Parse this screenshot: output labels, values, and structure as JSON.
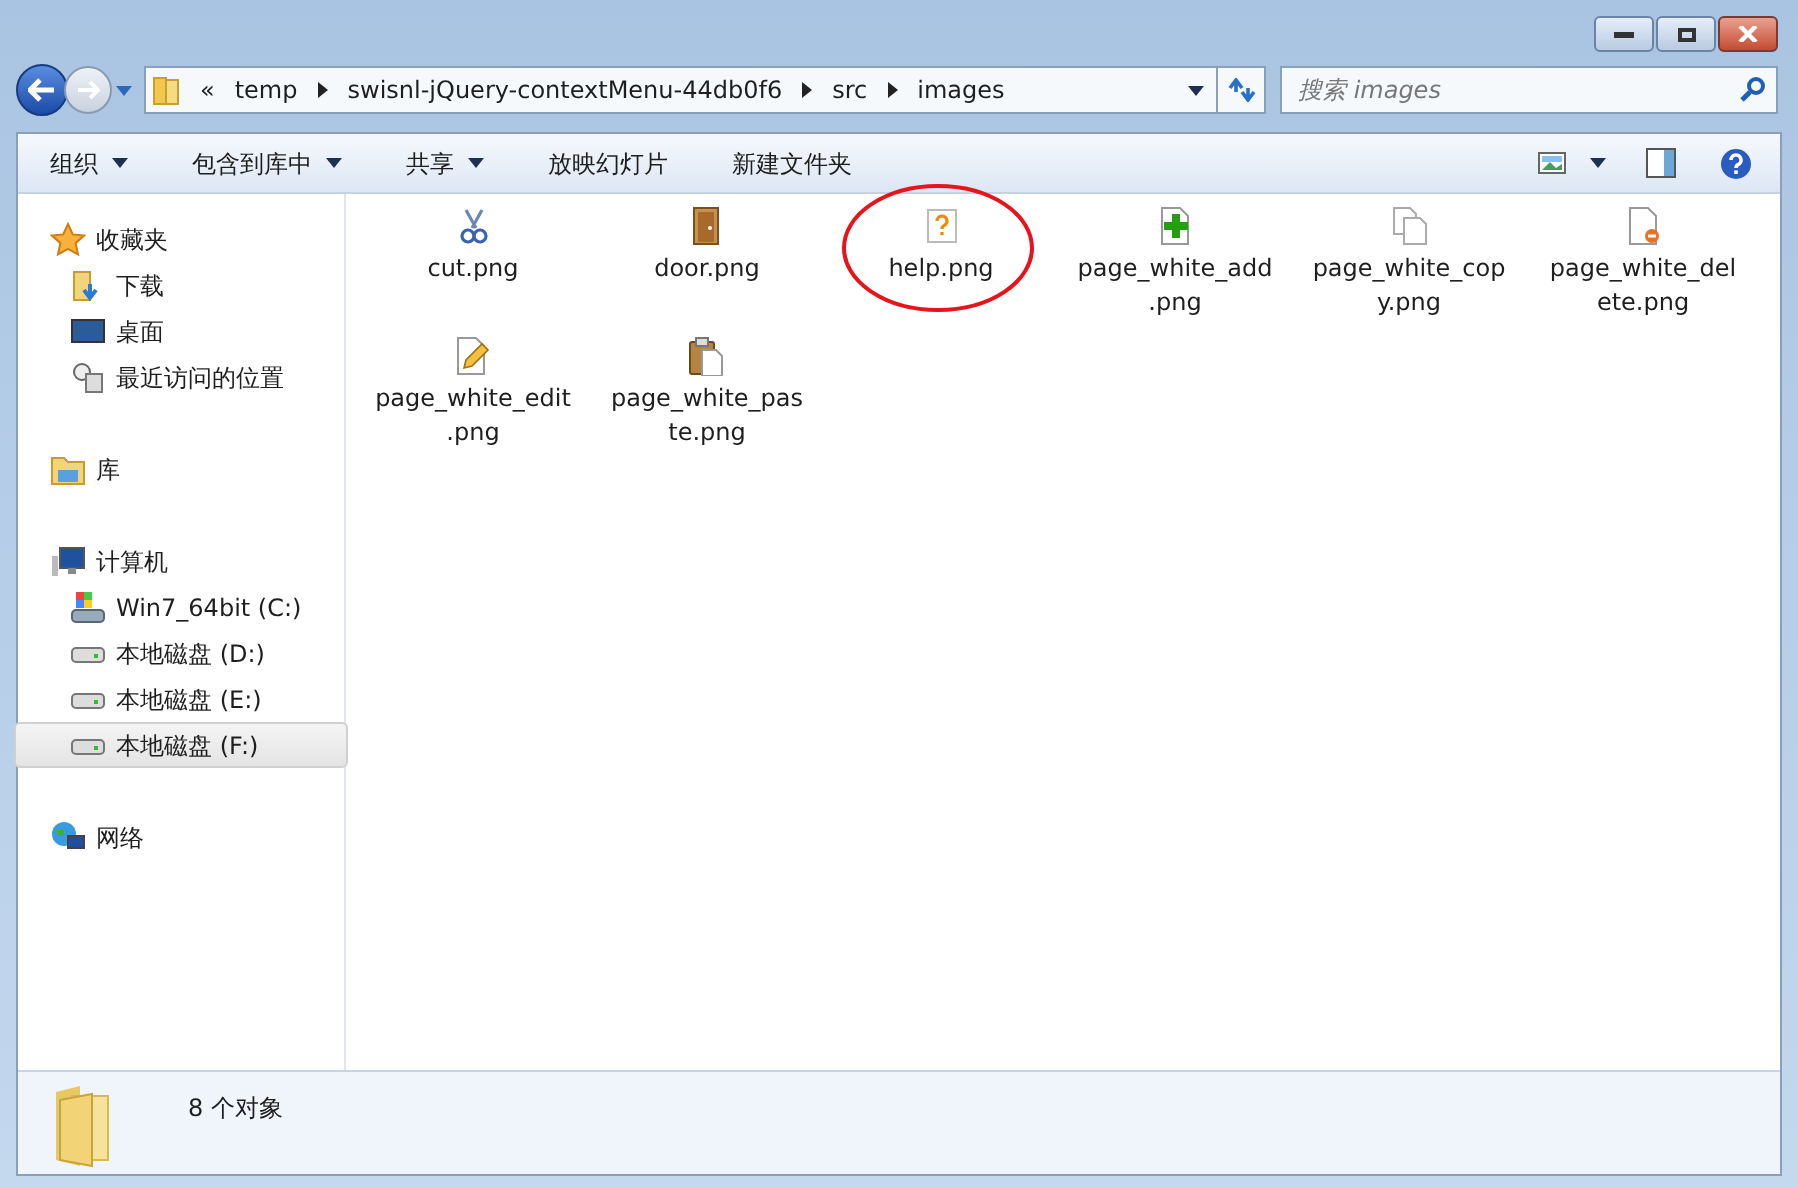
{
  "address_bar": {
    "overflow": "«",
    "crumbs": [
      "temp",
      "swisnl-jQuery-contextMenu-44db0f6",
      "src",
      "images"
    ]
  },
  "search": {
    "placeholder": "搜索 images"
  },
  "toolbar": {
    "commands": [
      {
        "label": "组织",
        "dropdown": true
      },
      {
        "label": "包含到库中",
        "dropdown": true
      },
      {
        "label": "共享",
        "dropdown": true
      },
      {
        "label": "放映幻灯片",
        "dropdown": false
      },
      {
        "label": "新建文件夹",
        "dropdown": false
      }
    ]
  },
  "sidebar": {
    "groups": [
      {
        "label": "收藏夹",
        "children": [
          {
            "label": "下载",
            "selected": false
          },
          {
            "label": "桌面",
            "selected": false
          },
          {
            "label": "最近访问的位置",
            "selected": false
          }
        ]
      },
      {
        "label": "库"
      },
      {
        "label": "计算机",
        "children": [
          {
            "label": "Win7_64bit (C:)",
            "selected": false
          },
          {
            "label": "本地磁盘 (D:)",
            "selected": false
          },
          {
            "label": "本地磁盘 (E:)",
            "selected": false
          },
          {
            "label": "本地磁盘 (F:)",
            "selected": true
          }
        ]
      },
      {
        "label": "网络"
      }
    ]
  },
  "files": [
    {
      "name_lines": [
        "cut.png"
      ],
      "circled": false
    },
    {
      "name_lines": [
        "door.png"
      ],
      "circled": false
    },
    {
      "name_lines": [
        "help.png"
      ],
      "circled": true
    },
    {
      "name_lines": [
        "page_white_add",
        ".png"
      ],
      "circled": false
    },
    {
      "name_lines": [
        "page_white_cop",
        "y.png"
      ],
      "circled": false
    },
    {
      "name_lines": [
        "page_white_del",
        "ete.png"
      ],
      "circled": false
    },
    {
      "name_lines": [
        "page_white_edit",
        ".png"
      ],
      "circled": false
    },
    {
      "name_lines": [
        "page_white_pas",
        "te.png"
      ],
      "circled": false
    }
  ],
  "status_bar": {
    "count": "8 个对象"
  }
}
